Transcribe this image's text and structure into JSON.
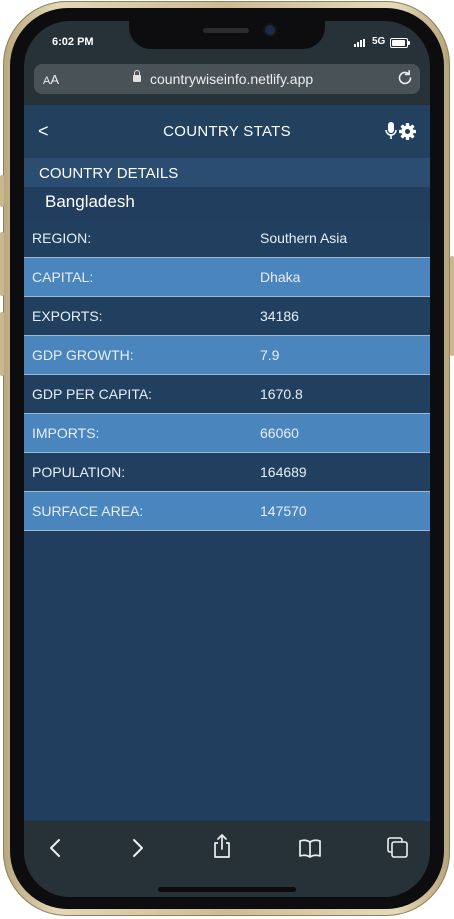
{
  "status": {
    "time": "6:02 PM",
    "network": "5G"
  },
  "browser": {
    "aa_small": "A",
    "aa_large": "A",
    "url": "countrywiseinfo.netlify.app"
  },
  "appbar": {
    "back_label": "<",
    "title": "COUNTRY STATS"
  },
  "section_title": "COUNTRY DETAILS",
  "country_name": "Bangladesh",
  "details": [
    {
      "label": "REGION:",
      "value": "Southern Asia"
    },
    {
      "label": "CAPITAL:",
      "value": "Dhaka"
    },
    {
      "label": "EXPORTS:",
      "value": "34186"
    },
    {
      "label": "GDP GROWTH:",
      "value": "7.9"
    },
    {
      "label": "GDP PER CAPITA:",
      "value": "1670.8"
    },
    {
      "label": "IMPORTS:",
      "value": "66060"
    },
    {
      "label": "POPULATION:",
      "value": "164689"
    },
    {
      "label": "SURFACE AREA:",
      "value": "147570"
    }
  ],
  "icons": [
    "mic-icon",
    "gear-icon",
    "lock-icon",
    "reload-icon",
    "back-arrow-icon",
    "forward-arrow-icon",
    "share-icon",
    "bookmarks-icon",
    "tabs-icon"
  ],
  "colors": {
    "appbar": "#21415f",
    "row": "#21405f",
    "row_alt": "#4a86bd",
    "section": "#2b4d72"
  }
}
